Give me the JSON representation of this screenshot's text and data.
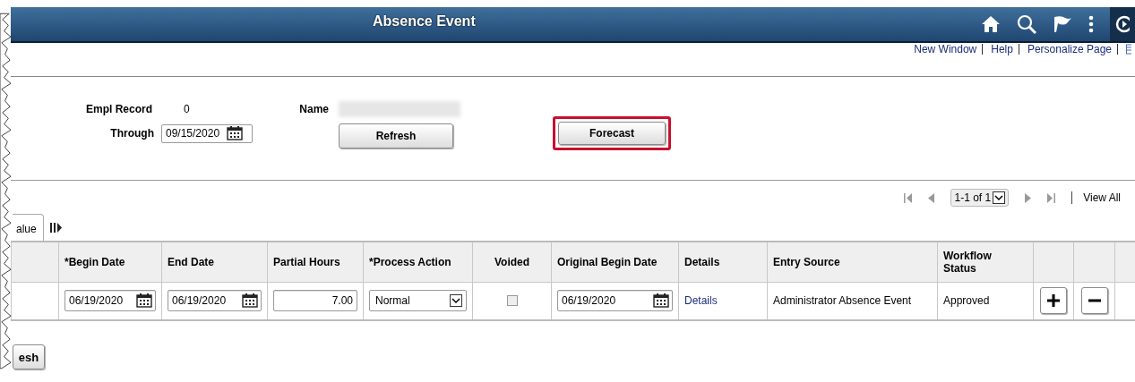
{
  "header": {
    "title": "Absence Event"
  },
  "links": [
    "New Window",
    "Help",
    "Personalize Page"
  ],
  "form": {
    "empl_record_label": "Empl Record",
    "empl_record": "0",
    "name_label": "Name",
    "through_label": "Through",
    "through": "09/15/2020",
    "refresh_button": "Refresh",
    "forecast_button": "Forecast",
    "forecast_highlighted": true
  },
  "pager": {
    "range": "1-1 of 1",
    "view_all": "View All"
  },
  "tab": {
    "label": "alue"
  },
  "table": {
    "columns": [
      "*Begin Date",
      "End Date",
      "Partial Hours",
      "*Process Action",
      "Voided",
      "Original Begin Date",
      "Details",
      "Entry Source",
      "Workflow Status"
    ],
    "rows": [
      {
        "begin_date": "06/19/2020",
        "end_date": "06/19/2020",
        "partial_hours": "7.00",
        "process_action": "Normal",
        "voided": false,
        "original_begin_date": "06/19/2020",
        "details": "Details",
        "entry_source": "Administrator Absence Event",
        "workflow_status": "Approved"
      }
    ]
  },
  "bottom_button": "esh"
}
